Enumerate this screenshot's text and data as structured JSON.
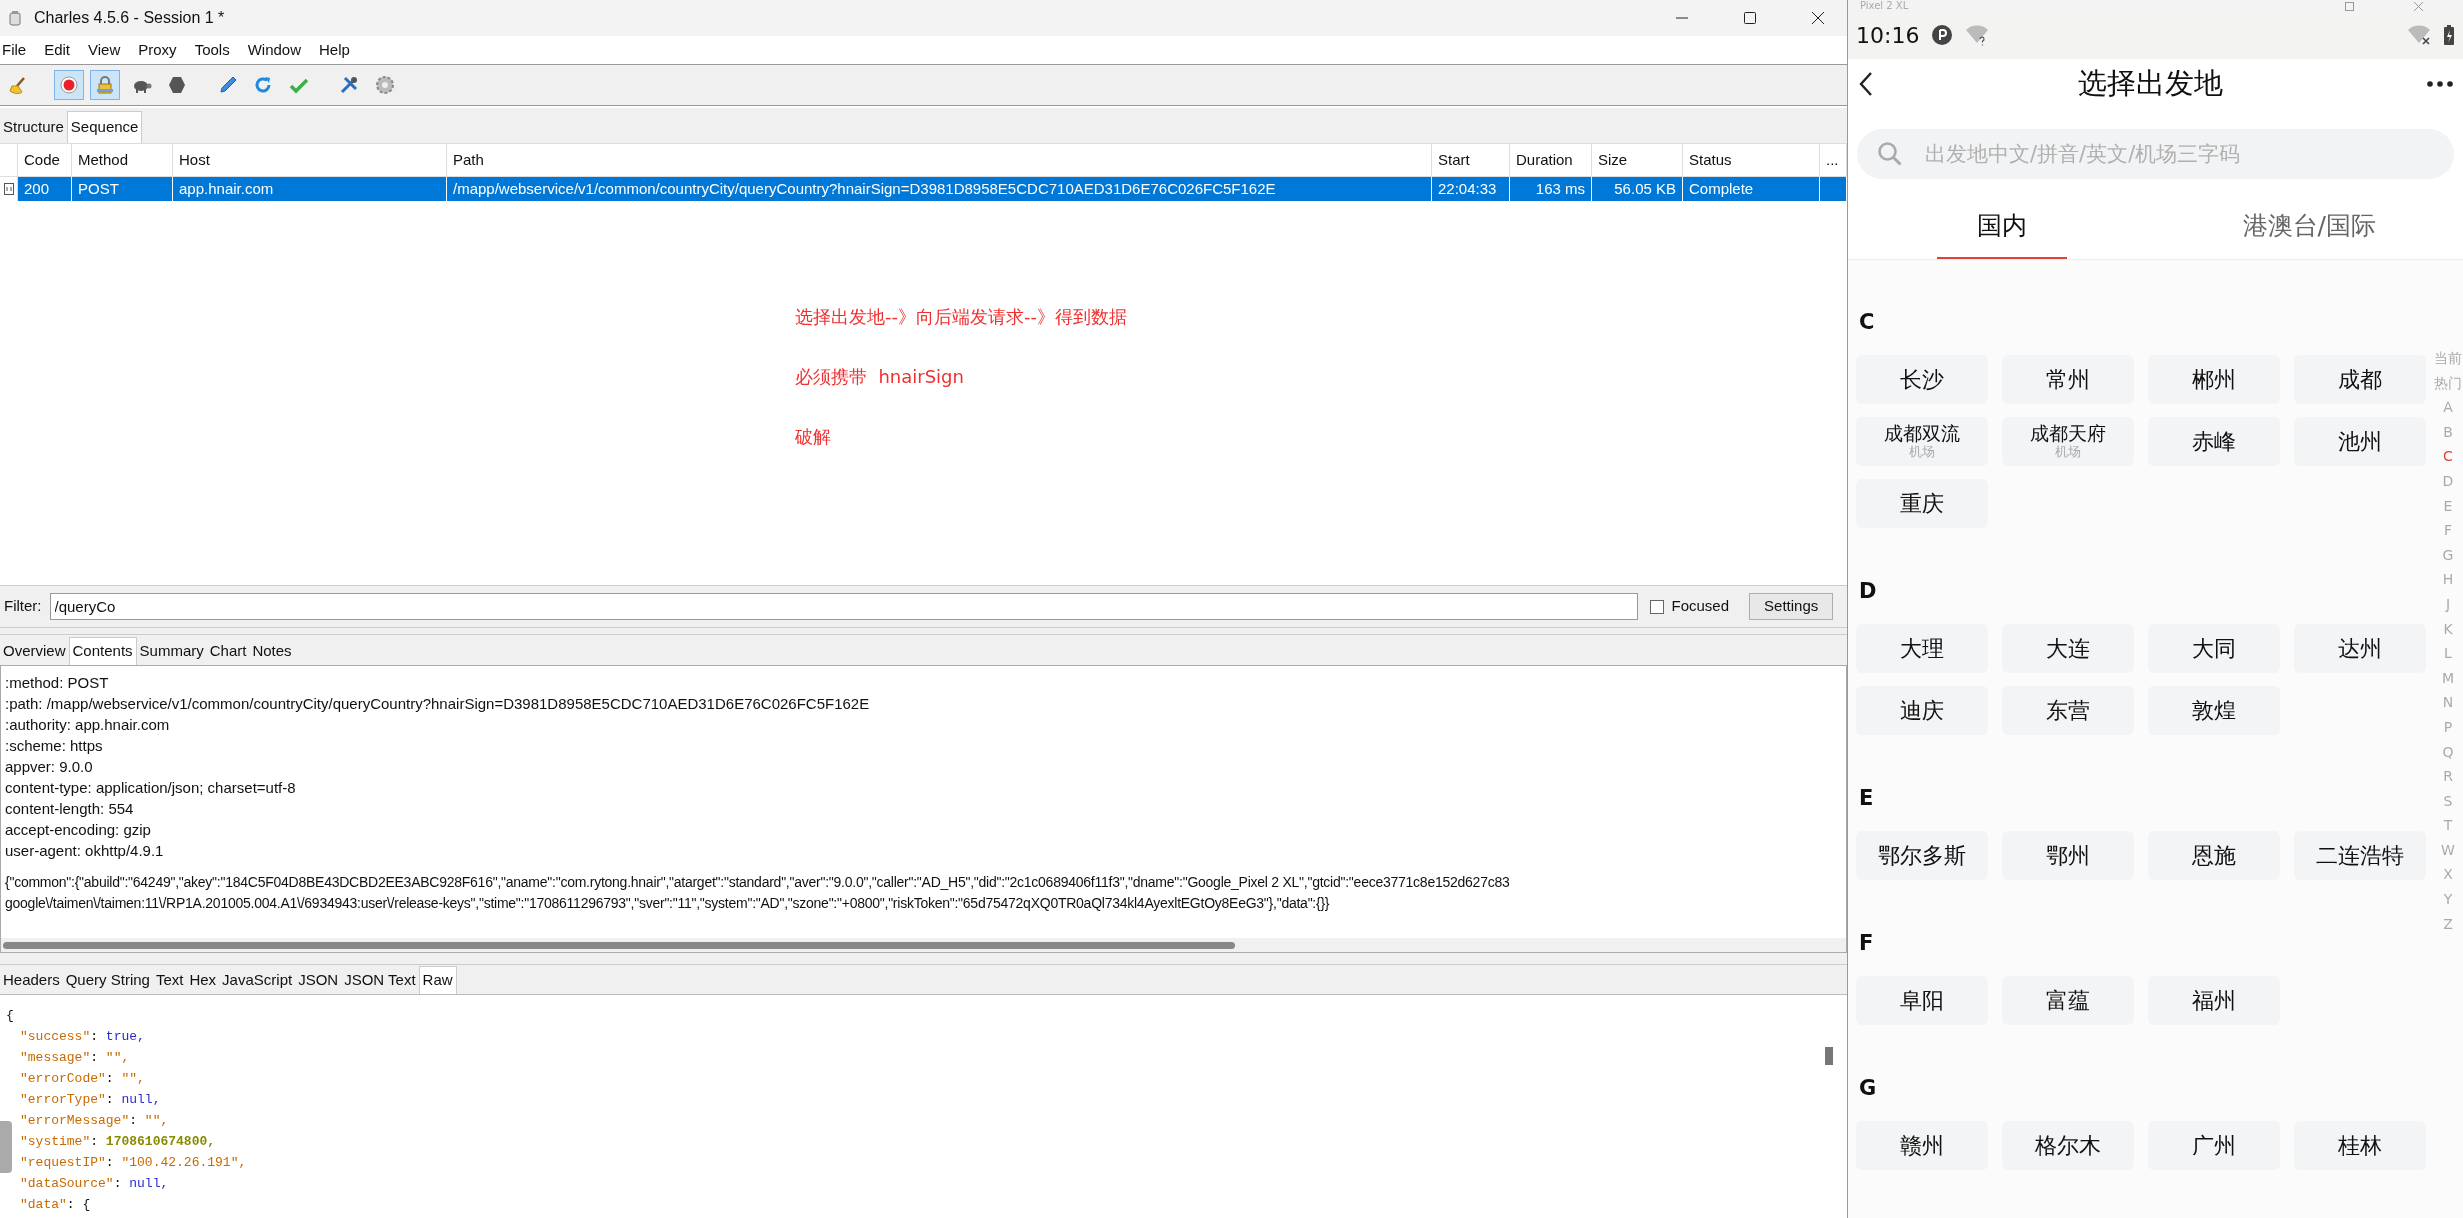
{
  "window": {
    "title": "Charles 4.5.6 - Session 1 *"
  },
  "menu": [
    "File",
    "Edit",
    "View",
    "Proxy",
    "Tools",
    "Window",
    "Help"
  ],
  "toolbar": [
    {
      "kind": "broom",
      "pressed": false
    },
    {
      "kind": "record",
      "pressed": true
    },
    {
      "kind": "lock",
      "pressed": true
    },
    {
      "kind": "turtle",
      "pressed": false
    },
    {
      "kind": "stop",
      "pressed": false
    },
    {
      "kind": "pen",
      "pressed": false
    },
    {
      "kind": "refresh",
      "pressed": false
    },
    {
      "kind": "check",
      "pressed": false
    },
    {
      "kind": "tools",
      "pressed": false
    },
    {
      "kind": "gear",
      "pressed": false
    }
  ],
  "view_tabs": [
    {
      "label": "Structure",
      "selected": false
    },
    {
      "label": "Sequence",
      "selected": true
    }
  ],
  "table": {
    "columns": [
      "Code",
      "Method",
      "Host",
      "Path",
      "Start",
      "Duration",
      "Size",
      "Status",
      "..."
    ],
    "rows": [
      {
        "selected": true,
        "cells": [
          "200",
          "POST",
          "app.hnair.com",
          "/mapp/webservice/v1/common/countryCity/queryCountry?hnairSign=D3981D8958E5CDC710AED31D6E76C026FC5F162E",
          "22:04:33",
          "163 ms",
          "56.05 KB",
          "Complete"
        ]
      }
    ]
  },
  "notes": [
    "选择出发地--》向后端发请求--》得到数据",
    "必须携带  hnairSign",
    "破解"
  ],
  "filter": {
    "label": "Filter:",
    "value": "/queryCo",
    "focused_label": "Focused",
    "focused": false,
    "settings": "Settings"
  },
  "detail_tabs": [
    {
      "label": "Overview",
      "selected": false
    },
    {
      "label": "Contents",
      "selected": true
    },
    {
      "label": "Summary",
      "selected": false
    },
    {
      "label": "Chart",
      "selected": false
    },
    {
      "label": "Notes",
      "selected": false
    }
  ],
  "request_headers": [
    ":method: POST",
    ":path: /mapp/webservice/v1/common/countryCity/queryCountry?hnairSign=D3981D8958E5CDC710AED31D6E76C026FC5F162E",
    ":authority: app.hnair.com",
    ":scheme: https",
    "appver: 9.0.0",
    "content-type: application/json; charset=utf-8",
    "content-length: 554",
    "accept-encoding: gzip",
    "user-agent: okhttp/4.9.1"
  ],
  "request_body": [
    "{\"common\":{\"abuild\":\"64249\",\"akey\":\"184C5F04D8BE43DCBD2EE3ABC928F616\",\"aname\":\"com.rytong.hnair\",\"atarget\":\"standard\",\"aver\":\"9.0.0\",\"caller\":\"AD_H5\",\"did\":\"2c1c0689406f11f3\",\"dname\":\"Google_Pixel 2 XL\",\"gtcid\":\"eece3771c8e152d627c83",
    "google\\/taimen\\/taimen:11\\/RP1A.201005.004.A1\\/6934943:user\\/release-keys\",\"stime\":\"1708611296793\",\"sver\":\"11\",\"system\":\"AD\",\"szone\":\"+0800\",\"riskToken\":\"65d75472qXQ0TR0aQl734kl4AyexltEGtOy8EeG3\"},\"data\":{}}"
  ],
  "body_tabs": [
    {
      "label": "Headers",
      "selected": false
    },
    {
      "label": "Query String",
      "selected": false
    },
    {
      "label": "Text",
      "selected": false
    },
    {
      "label": "Hex",
      "selected": false
    },
    {
      "label": "JavaScript",
      "selected": false
    },
    {
      "label": "JSON",
      "selected": false
    },
    {
      "label": "JSON Text",
      "selected": false
    },
    {
      "label": "Raw",
      "selected": true
    }
  ],
  "response": [
    {
      "kind": "brace",
      "text": "{"
    },
    {
      "kind": "literal",
      "key": "\"success\"",
      "sep": ": ",
      "value": "true,"
    },
    {
      "kind": "string",
      "key": "\"message\"",
      "sep": ": ",
      "value": "\"\","
    },
    {
      "kind": "string",
      "key": "\"errorCode\"",
      "sep": ": ",
      "value": "\"\","
    },
    {
      "kind": "literal",
      "key": "\"errorType\"",
      "sep": ": ",
      "value": "null,"
    },
    {
      "kind": "string",
      "key": "\"errorMessage\"",
      "sep": ": ",
      "value": "\"\","
    },
    {
      "kind": "number",
      "key": "\"systime\"",
      "sep": ": ",
      "value": "1708610674800,"
    },
    {
      "kind": "string",
      "key": "\"requestIP\"",
      "sep": ": ",
      "value": "\"100.42.26.191\","
    },
    {
      "kind": "literal",
      "key": "\"dataSource\"",
      "sep": ": ",
      "value": "null,"
    },
    {
      "kind": "open",
      "key": "\"data\"",
      "sep": ": ",
      "value": "{"
    }
  ],
  "phone": {
    "device": "Pixel 2 XL",
    "time": "10:16",
    "title": "选择出发地",
    "search_placeholder": "出发地中文/拼音/英文/机场三字码",
    "tabs": [
      {
        "label": "国内",
        "selected": true
      },
      {
        "label": "港澳台/国际",
        "selected": false
      }
    ],
    "sections": [
      {
        "letter": "C",
        "cities": [
          {
            "name": "长沙"
          },
          {
            "name": "常州"
          },
          {
            "name": "郴州"
          },
          {
            "name": "成都"
          },
          {
            "name": "成都双流",
            "sub": "机场"
          },
          {
            "name": "成都天府",
            "sub": "机场"
          },
          {
            "name": "赤峰"
          },
          {
            "name": "池州"
          },
          {
            "name": "重庆"
          }
        ]
      },
      {
        "letter": "D",
        "cities": [
          {
            "name": "大理"
          },
          {
            "name": "大连"
          },
          {
            "name": "大同"
          },
          {
            "name": "达州"
          },
          {
            "name": "迪庆"
          },
          {
            "name": "东营"
          },
          {
            "name": "敦煌"
          }
        ]
      },
      {
        "letter": "E",
        "cities": [
          {
            "name": "鄂尔多斯"
          },
          {
            "name": "鄂州"
          },
          {
            "name": "恩施"
          },
          {
            "name": "二连浩特"
          }
        ]
      },
      {
        "letter": "F",
        "cities": [
          {
            "name": "阜阳"
          },
          {
            "name": "富蕴"
          },
          {
            "name": "福州"
          }
        ]
      },
      {
        "letter": "G",
        "cities": [
          {
            "name": "赣州"
          },
          {
            "name": "格尔木"
          },
          {
            "name": "广州"
          },
          {
            "name": "桂林"
          }
        ]
      }
    ],
    "index": [
      {
        "label": "当前",
        "selected": false
      },
      {
        "label": "热门",
        "selected": false
      },
      {
        "label": "A",
        "selected": false
      },
      {
        "label": "B",
        "selected": false
      },
      {
        "label": "C",
        "selected": true
      },
      {
        "label": "D",
        "selected": false
      },
      {
        "label": "E",
        "selected": false
      },
      {
        "label": "F",
        "selected": false
      },
      {
        "label": "G",
        "selected": false
      },
      {
        "label": "H",
        "selected": false
      },
      {
        "label": "J",
        "selected": false
      },
      {
        "label": "K",
        "selected": false
      },
      {
        "label": "L",
        "selected": false
      },
      {
        "label": "M",
        "selected": false
      },
      {
        "label": "N",
        "selected": false
      },
      {
        "label": "P",
        "selected": false
      },
      {
        "label": "Q",
        "selected": false
      },
      {
        "label": "R",
        "selected": false
      },
      {
        "label": "S",
        "selected": false
      },
      {
        "label": "T",
        "selected": false
      },
      {
        "label": "W",
        "selected": false
      },
      {
        "label": "X",
        "selected": false
      },
      {
        "label": "Y",
        "selected": false
      },
      {
        "label": "Z",
        "selected": false
      }
    ]
  }
}
